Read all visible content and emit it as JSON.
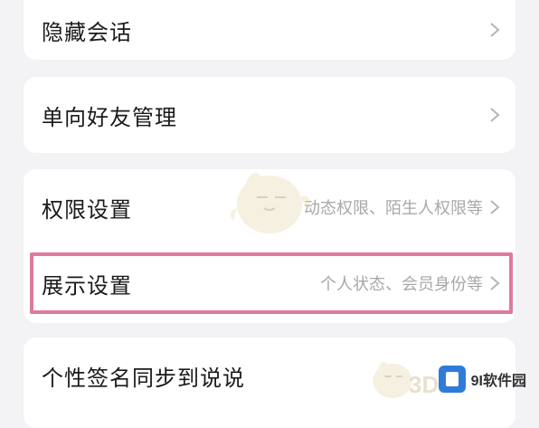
{
  "settings": {
    "rows": [
      {
        "label": "隐藏会话",
        "subtitle": ""
      },
      {
        "label": "单向好友管理",
        "subtitle": ""
      },
      {
        "label": "权限设置",
        "subtitle": "动态权限、陌生人权限等"
      },
      {
        "label": "展示设置",
        "subtitle": "个人状态、会员身份等"
      },
      {
        "label": "个性签名同步到说说",
        "subtitle": ""
      }
    ]
  },
  "watermark": {
    "site_text": "9I软件园",
    "logo_3d_text": "3D"
  },
  "colors": {
    "background": "#f3f3f5",
    "card": "#ffffff",
    "highlight_border": "#e07a9c",
    "chevron": "#b5b5b5"
  }
}
